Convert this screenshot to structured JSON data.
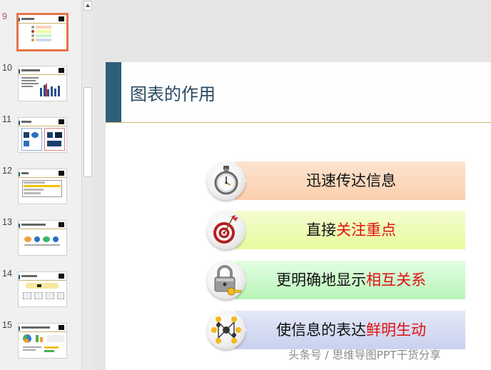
{
  "thumbnails": [
    {
      "number": "9",
      "selected": true
    },
    {
      "number": "10",
      "selected": false
    },
    {
      "number": "11",
      "selected": false
    },
    {
      "number": "12",
      "selected": false
    },
    {
      "number": "13",
      "selected": false
    },
    {
      "number": "14",
      "selected": false
    },
    {
      "number": "15",
      "selected": false
    }
  ],
  "slide": {
    "title": "图表的作用",
    "items": [
      {
        "icon": "stopwatch-icon",
        "text": "迅速传达信息",
        "highlight": "",
        "colors": [
          "#fde3cf",
          "#fbcfae"
        ]
      },
      {
        "icon": "target-icon",
        "text": "直接",
        "highlight": "关注重点",
        "colors": [
          "#f4fdcf",
          "#e6fb9e"
        ]
      },
      {
        "icon": "padlock-icon",
        "text": "更明确地显示",
        "highlight": "相互关系",
        "colors": [
          "#e2fde2",
          "#b9f5b9"
        ]
      },
      {
        "icon": "network-icon",
        "text": "使信息的表达",
        "highlight": "鲜明生动",
        "colors": [
          "#e4e8f6",
          "#c9d1ee"
        ]
      }
    ]
  },
  "watermark": "头条号 / 思维导图PPT干货分享"
}
